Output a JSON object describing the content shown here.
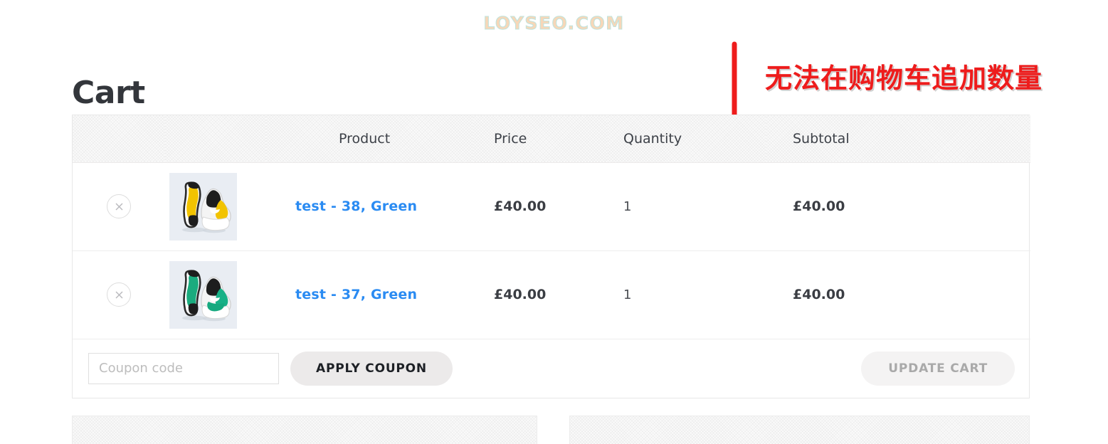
{
  "watermark": {
    "text": "LOYSEO.COM",
    "fill_color": "#f7d7b8",
    "outline_color": "#bfe3dc"
  },
  "page": {
    "title": "Cart"
  },
  "annotation": {
    "text": "无法在购物车追加数量",
    "color": "#ee1c1c",
    "arrow_icon": "down-arrow-icon",
    "arrow_color": "#ee1c1c"
  },
  "cart": {
    "headers": {
      "remove": "",
      "thumbnail": "",
      "product": "Product",
      "price": "Price",
      "quantity": "Quantity",
      "subtotal": "Subtotal"
    },
    "rows": [
      {
        "remove_icon": "close-icon",
        "thumbnail_alt": "sneaker-pair-yellow",
        "name": "test - 38, Green",
        "price": "£40.00",
        "quantity": "1",
        "subtotal": "£40.00"
      },
      {
        "remove_icon": "close-icon",
        "thumbnail_alt": "sneaker-pair-green",
        "name": "test - 37, Green",
        "price": "£40.00",
        "quantity": "1",
        "subtotal": "£40.00"
      }
    ],
    "actions": {
      "coupon_value": "",
      "coupon_placeholder": "Coupon code",
      "apply_coupon_label": "APPLY COUPON",
      "update_cart_label": "UPDATE CART"
    },
    "link_color": "#2a8bf2"
  }
}
